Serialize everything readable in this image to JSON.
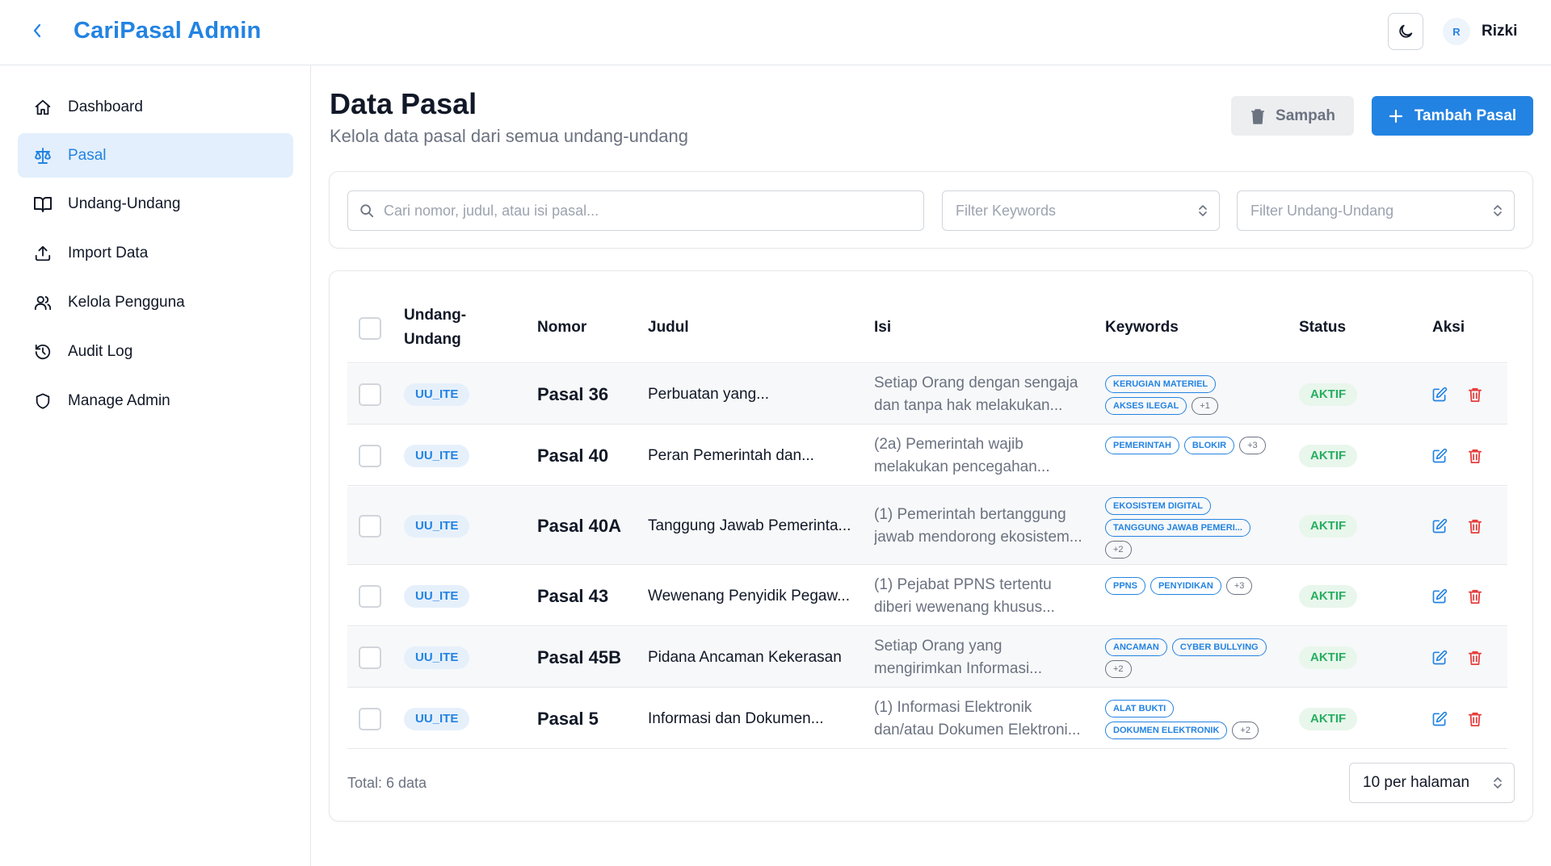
{
  "header": {
    "app_title": "CariPasal Admin",
    "user_initial": "R",
    "user_name": "Rizki"
  },
  "sidebar": {
    "items": [
      {
        "label": "Dashboard",
        "icon": "home-icon",
        "active": false
      },
      {
        "label": "Pasal",
        "icon": "scale-icon",
        "active": true
      },
      {
        "label": "Undang-Undang",
        "icon": "book-icon",
        "active": false
      },
      {
        "label": "Import Data",
        "icon": "upload-icon",
        "active": false
      },
      {
        "label": "Kelola Pengguna",
        "icon": "users-icon",
        "active": false
      },
      {
        "label": "Audit Log",
        "icon": "history-icon",
        "active": false
      },
      {
        "label": "Manage Admin",
        "icon": "shield-icon",
        "active": false
      }
    ]
  },
  "page": {
    "title": "Data Pasal",
    "subtitle": "Kelola data pasal dari semua undang-undang",
    "trash_label": "Sampah",
    "add_label": "Tambah Pasal"
  },
  "filters": {
    "search_placeholder": "Cari nomor, judul, atau isi pasal...",
    "keywords_placeholder": "Filter Keywords",
    "uu_placeholder": "Filter Undang-Undang"
  },
  "table": {
    "headers": {
      "undang_line1": "Undang-",
      "undang_line2": "Undang",
      "nomor": "Nomor",
      "judul": "Judul",
      "isi": "Isi",
      "keywords": "Keywords",
      "status": "Status",
      "aksi": "Aksi"
    },
    "rows": [
      {
        "uu": "UU_ITE",
        "nomor": "Pasal 36",
        "judul": "Perbuatan yang...",
        "isi1": "Setiap Orang dengan sengaja",
        "isi2": "dan tanpa hak melakukan...",
        "keywords": [
          "KERUGIAN MATERIEL",
          "AKSES ILEGAL"
        ],
        "more": "+1",
        "status": "AKTIF"
      },
      {
        "uu": "UU_ITE",
        "nomor": "Pasal 40",
        "judul": "Peran Pemerintah dan...",
        "isi1": "(2a) Pemerintah wajib",
        "isi2": "melakukan pencegahan...",
        "keywords": [
          "PEMERINTAH",
          "BLOKIR"
        ],
        "more": "+3",
        "status": "AKTIF"
      },
      {
        "uu": "UU_ITE",
        "nomor": "Pasal 40A",
        "judul": "Tanggung Jawab Pemerinta...",
        "isi1": "(1) Pemerintah bertanggung",
        "isi2": "jawab mendorong ekosistem...",
        "keywords": [
          "EKOSISTEM DIGITAL",
          "TANGGUNG JAWAB PEMERI..."
        ],
        "more": "+2",
        "status": "AKTIF"
      },
      {
        "uu": "UU_ITE",
        "nomor": "Pasal 43",
        "judul": "Wewenang Penyidik Pegaw...",
        "isi1": "(1) Pejabat PPNS tertentu",
        "isi2": "diberi wewenang khusus...",
        "keywords": [
          "PPNS",
          "PENYIDIKAN"
        ],
        "more": "+3",
        "status": "AKTIF"
      },
      {
        "uu": "UU_ITE",
        "nomor": "Pasal 45B",
        "judul": "Pidana Ancaman Kekerasan",
        "isi1": "Setiap Orang yang",
        "isi2": "mengirimkan Informasi...",
        "keywords": [
          "ANCAMAN",
          "CYBER BULLYING"
        ],
        "more": "+2",
        "status": "AKTIF"
      },
      {
        "uu": "UU_ITE",
        "nomor": "Pasal 5",
        "judul": "Informasi dan Dokumen...",
        "isi1": "(1) Informasi Elektronik",
        "isi2": "dan/atau Dokumen Elektroni...",
        "keywords": [
          "ALAT BUKTI",
          "DOKUMEN ELEKTRONIK"
        ],
        "more": "+2",
        "status": "AKTIF"
      }
    ]
  },
  "footer": {
    "total": "Total: 6 data",
    "per_page": "10 per halaman"
  },
  "colors": {
    "accent": "#2383e2",
    "active_green": "#27ae60",
    "delete_red": "#e53e3e",
    "muted": "#6b7280"
  }
}
